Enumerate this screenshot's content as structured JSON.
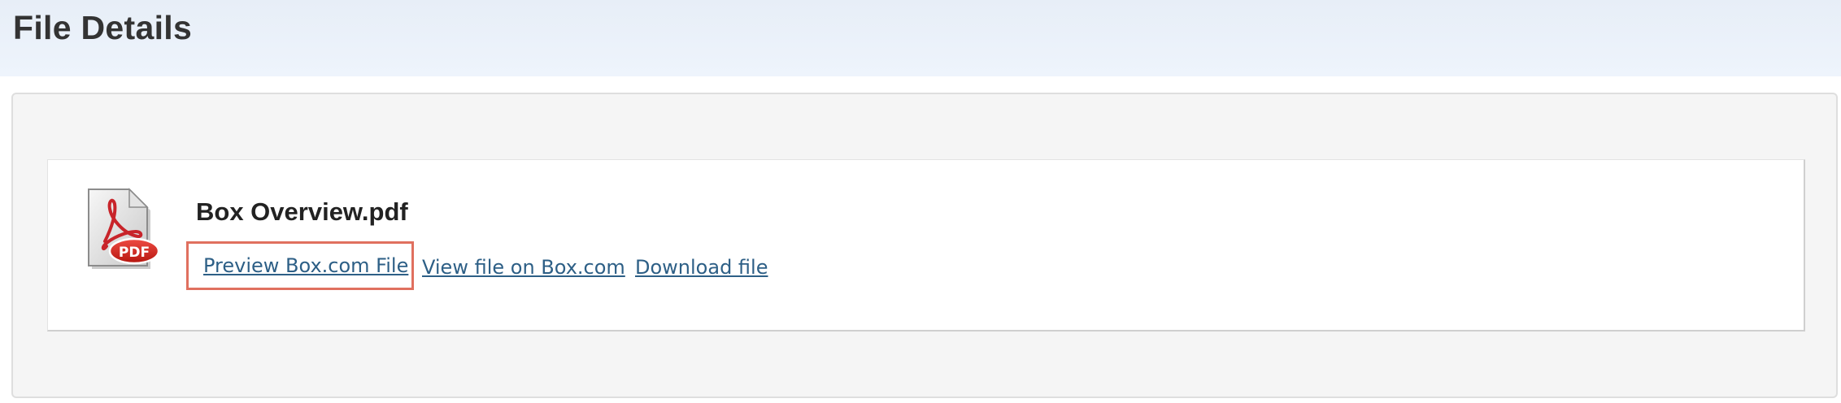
{
  "header": {
    "title": "File Details"
  },
  "file": {
    "name": "Box Overview.pdf",
    "icon": "pdf-file-icon",
    "icon_badge": "PDF"
  },
  "actions": {
    "preview_label": "Preview Box.com File",
    "view_label": "View file on Box.com",
    "download_label": "Download file"
  },
  "colors": {
    "link": "#2d5f86",
    "highlight_border": "#e0705f",
    "header_bg": "#eaf1fa",
    "panel_bg": "#f5f5f5"
  }
}
